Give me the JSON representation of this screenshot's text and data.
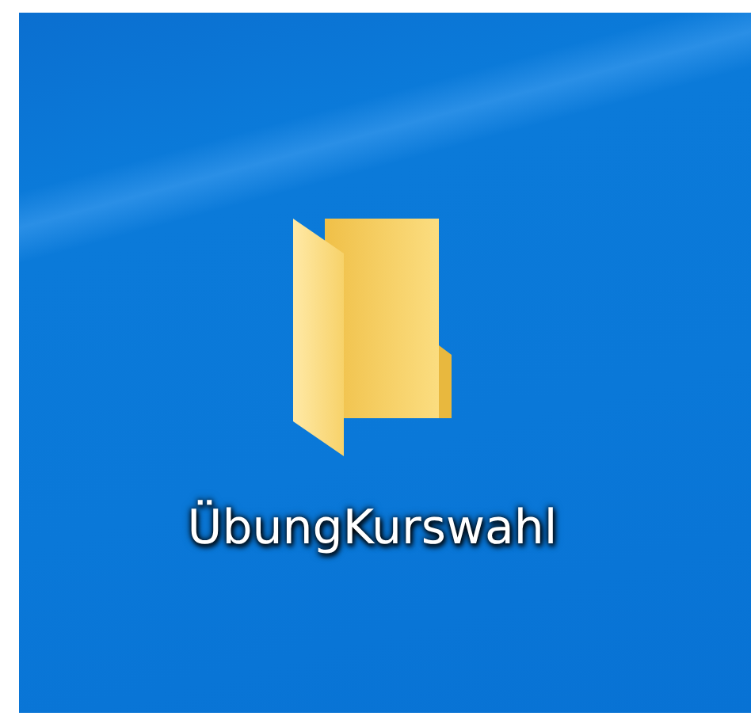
{
  "desktop": {
    "icons": [
      {
        "label": "ÜbungKurswahl"
      }
    ]
  }
}
